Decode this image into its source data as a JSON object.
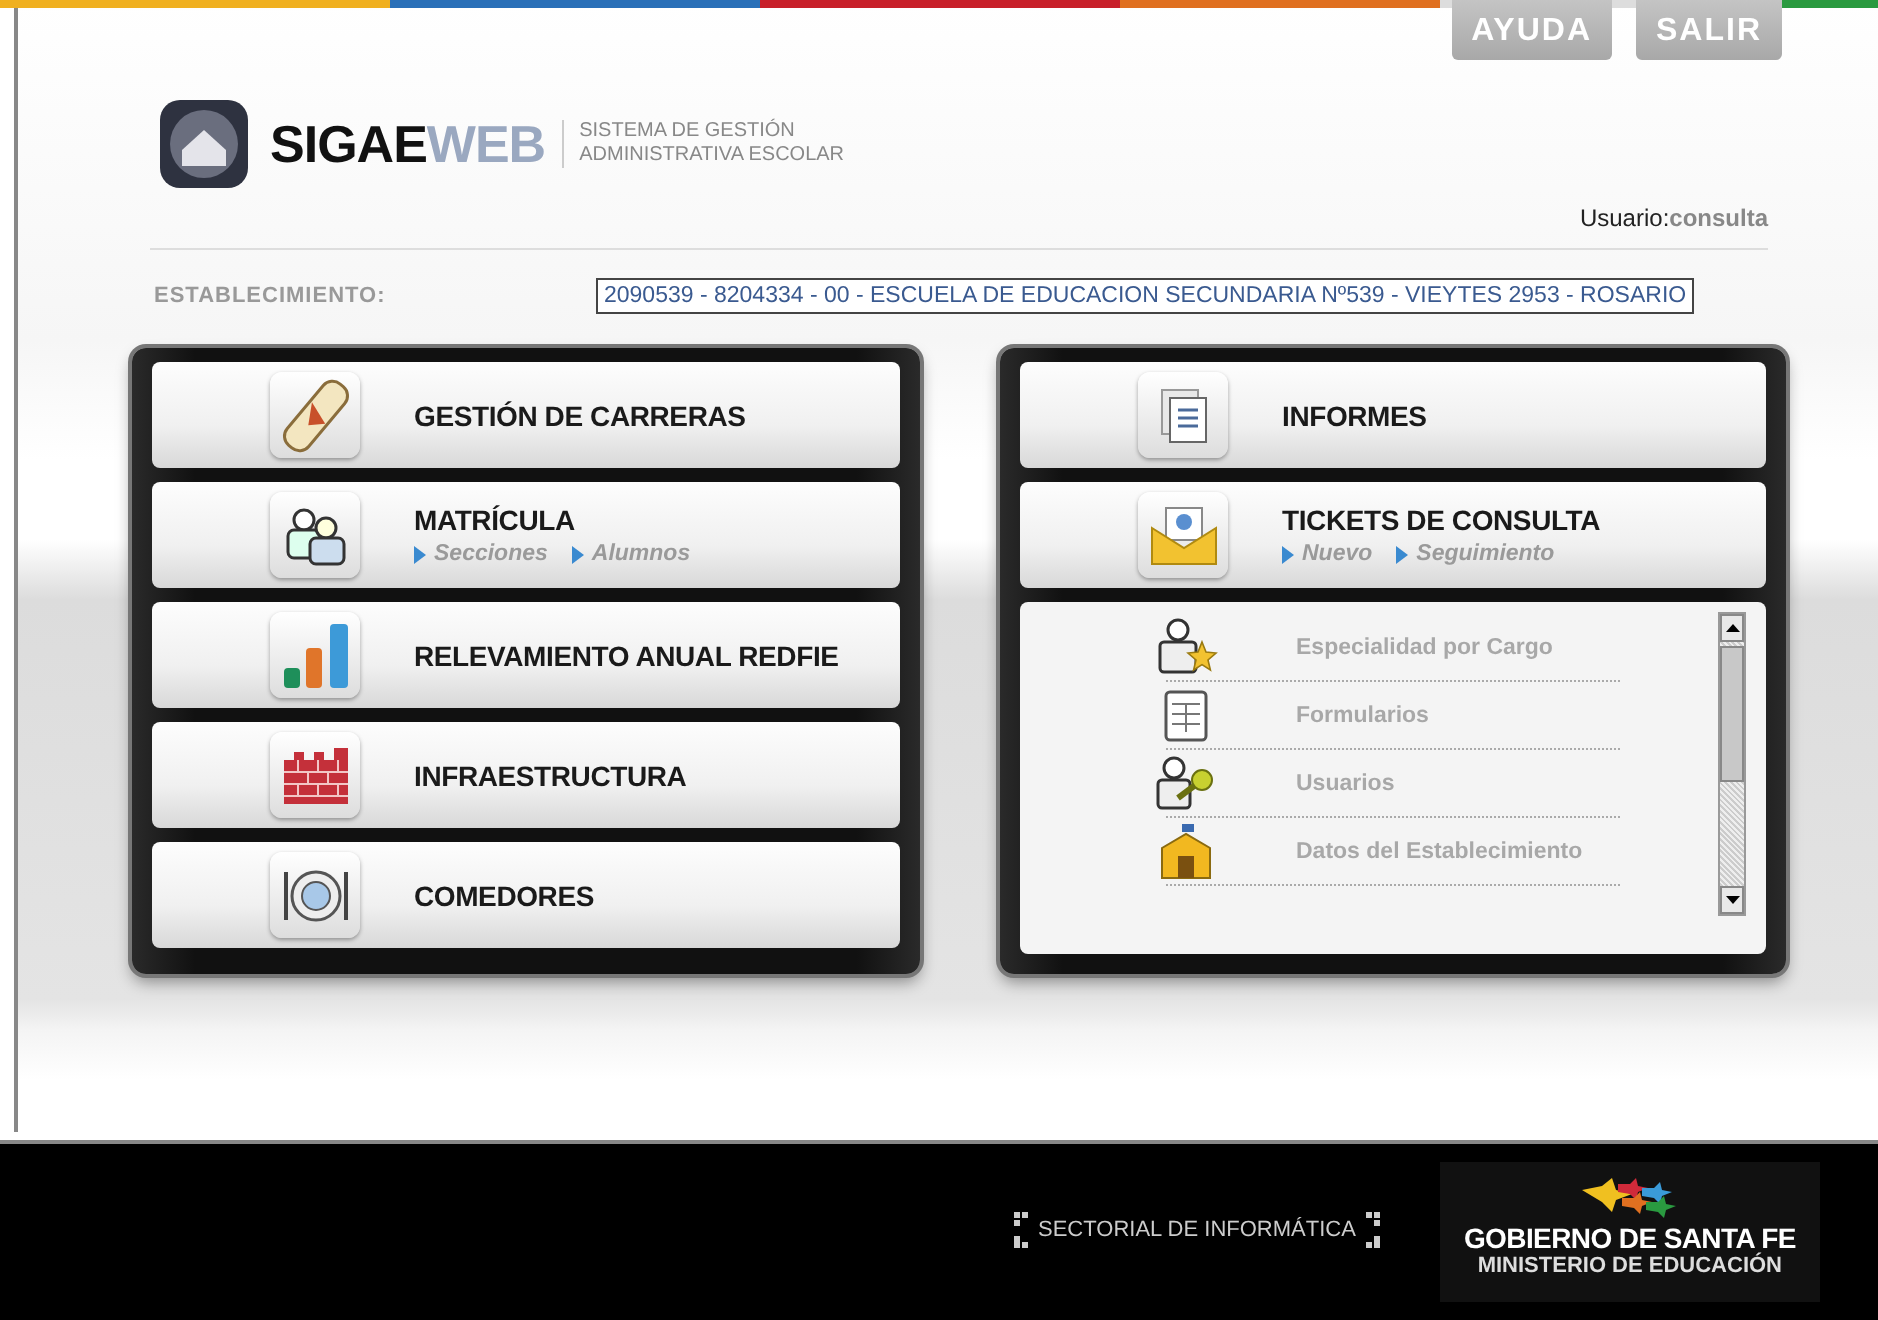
{
  "header": {
    "buttons": [
      {
        "label": "AYUDA"
      },
      {
        "label": "SALIR"
      }
    ],
    "logo": {
      "name_bold": "SIGAE",
      "name_light": "WEB",
      "tagline": [
        "SISTEMA DE GESTIÓN",
        "ADMINISTRATIVA ESCOLAR"
      ]
    },
    "user": {
      "label": "Usuario:",
      "value": "consulta"
    }
  },
  "establecimiento": {
    "label": "ESTABLECIMIENTO:",
    "value": "2090539 - 8204334 - 00 - ESCUELA DE EDUCACION SECUNDARIA Nº539 - VIEYTES 2953 - ROSARIO"
  },
  "left_menu": [
    {
      "title": "GESTIÓN DE CARRERAS"
    },
    {
      "title": "MATRÍCULA",
      "links": [
        "Secciones",
        "Alumnos"
      ]
    },
    {
      "title": "RELEVAMIENTO ANUAL REDFIE"
    },
    {
      "title": "INFRAESTRUCTURA"
    },
    {
      "title": "COMEDORES"
    }
  ],
  "right_menu": [
    {
      "title": "INFORMES"
    },
    {
      "title": "TICKETS DE CONSULTA",
      "links": [
        "Nuevo",
        "Seguimiento"
      ]
    }
  ],
  "admin_list": [
    "Especialidad por Cargo",
    "Formularios",
    "Usuarios",
    "Datos del Establecimiento"
  ],
  "footer": {
    "sectorial": "SECTORIAL DE INFORMÁTICA",
    "government": "GOBIERNO DE SANTA FE",
    "ministry": "MINISTERIO DE EDUCACIÓN"
  }
}
